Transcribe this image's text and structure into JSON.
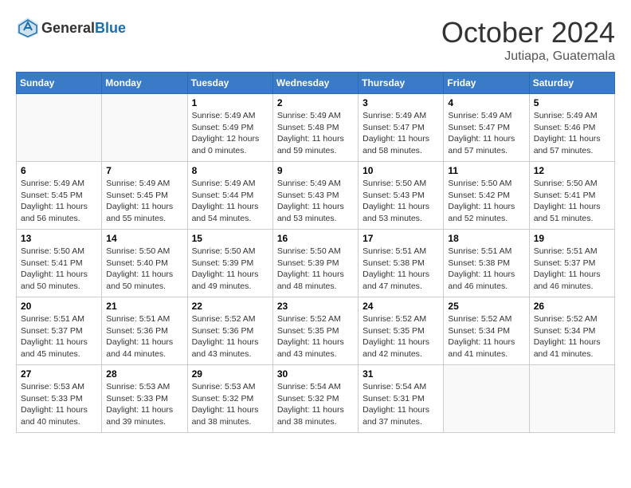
{
  "header": {
    "logo_general": "General",
    "logo_blue": "Blue",
    "month_title": "October 2024",
    "subtitle": "Jutiapa, Guatemala"
  },
  "weekdays": [
    "Sunday",
    "Monday",
    "Tuesday",
    "Wednesday",
    "Thursday",
    "Friday",
    "Saturday"
  ],
  "weeks": [
    [
      {
        "day": "",
        "sunrise": "",
        "sunset": "",
        "daylight": "",
        "empty": true
      },
      {
        "day": "",
        "sunrise": "",
        "sunset": "",
        "daylight": "",
        "empty": true
      },
      {
        "day": "1",
        "sunrise": "Sunrise: 5:49 AM",
        "sunset": "Sunset: 5:49 PM",
        "daylight": "Daylight: 12 hours and 0 minutes."
      },
      {
        "day": "2",
        "sunrise": "Sunrise: 5:49 AM",
        "sunset": "Sunset: 5:48 PM",
        "daylight": "Daylight: 11 hours and 59 minutes."
      },
      {
        "day": "3",
        "sunrise": "Sunrise: 5:49 AM",
        "sunset": "Sunset: 5:47 PM",
        "daylight": "Daylight: 11 hours and 58 minutes."
      },
      {
        "day": "4",
        "sunrise": "Sunrise: 5:49 AM",
        "sunset": "Sunset: 5:47 PM",
        "daylight": "Daylight: 11 hours and 57 minutes."
      },
      {
        "day": "5",
        "sunrise": "Sunrise: 5:49 AM",
        "sunset": "Sunset: 5:46 PM",
        "daylight": "Daylight: 11 hours and 57 minutes."
      }
    ],
    [
      {
        "day": "6",
        "sunrise": "Sunrise: 5:49 AM",
        "sunset": "Sunset: 5:45 PM",
        "daylight": "Daylight: 11 hours and 56 minutes."
      },
      {
        "day": "7",
        "sunrise": "Sunrise: 5:49 AM",
        "sunset": "Sunset: 5:45 PM",
        "daylight": "Daylight: 11 hours and 55 minutes."
      },
      {
        "day": "8",
        "sunrise": "Sunrise: 5:49 AM",
        "sunset": "Sunset: 5:44 PM",
        "daylight": "Daylight: 11 hours and 54 minutes."
      },
      {
        "day": "9",
        "sunrise": "Sunrise: 5:49 AM",
        "sunset": "Sunset: 5:43 PM",
        "daylight": "Daylight: 11 hours and 53 minutes."
      },
      {
        "day": "10",
        "sunrise": "Sunrise: 5:50 AM",
        "sunset": "Sunset: 5:43 PM",
        "daylight": "Daylight: 11 hours and 53 minutes."
      },
      {
        "day": "11",
        "sunrise": "Sunrise: 5:50 AM",
        "sunset": "Sunset: 5:42 PM",
        "daylight": "Daylight: 11 hours and 52 minutes."
      },
      {
        "day": "12",
        "sunrise": "Sunrise: 5:50 AM",
        "sunset": "Sunset: 5:41 PM",
        "daylight": "Daylight: 11 hours and 51 minutes."
      }
    ],
    [
      {
        "day": "13",
        "sunrise": "Sunrise: 5:50 AM",
        "sunset": "Sunset: 5:41 PM",
        "daylight": "Daylight: 11 hours and 50 minutes."
      },
      {
        "day": "14",
        "sunrise": "Sunrise: 5:50 AM",
        "sunset": "Sunset: 5:40 PM",
        "daylight": "Daylight: 11 hours and 50 minutes."
      },
      {
        "day": "15",
        "sunrise": "Sunrise: 5:50 AM",
        "sunset": "Sunset: 5:39 PM",
        "daylight": "Daylight: 11 hours and 49 minutes."
      },
      {
        "day": "16",
        "sunrise": "Sunrise: 5:50 AM",
        "sunset": "Sunset: 5:39 PM",
        "daylight": "Daylight: 11 hours and 48 minutes."
      },
      {
        "day": "17",
        "sunrise": "Sunrise: 5:51 AM",
        "sunset": "Sunset: 5:38 PM",
        "daylight": "Daylight: 11 hours and 47 minutes."
      },
      {
        "day": "18",
        "sunrise": "Sunrise: 5:51 AM",
        "sunset": "Sunset: 5:38 PM",
        "daylight": "Daylight: 11 hours and 46 minutes."
      },
      {
        "day": "19",
        "sunrise": "Sunrise: 5:51 AM",
        "sunset": "Sunset: 5:37 PM",
        "daylight": "Daylight: 11 hours and 46 minutes."
      }
    ],
    [
      {
        "day": "20",
        "sunrise": "Sunrise: 5:51 AM",
        "sunset": "Sunset: 5:37 PM",
        "daylight": "Daylight: 11 hours and 45 minutes."
      },
      {
        "day": "21",
        "sunrise": "Sunrise: 5:51 AM",
        "sunset": "Sunset: 5:36 PM",
        "daylight": "Daylight: 11 hours and 44 minutes."
      },
      {
        "day": "22",
        "sunrise": "Sunrise: 5:52 AM",
        "sunset": "Sunset: 5:36 PM",
        "daylight": "Daylight: 11 hours and 43 minutes."
      },
      {
        "day": "23",
        "sunrise": "Sunrise: 5:52 AM",
        "sunset": "Sunset: 5:35 PM",
        "daylight": "Daylight: 11 hours and 43 minutes."
      },
      {
        "day": "24",
        "sunrise": "Sunrise: 5:52 AM",
        "sunset": "Sunset: 5:35 PM",
        "daylight": "Daylight: 11 hours and 42 minutes."
      },
      {
        "day": "25",
        "sunrise": "Sunrise: 5:52 AM",
        "sunset": "Sunset: 5:34 PM",
        "daylight": "Daylight: 11 hours and 41 minutes."
      },
      {
        "day": "26",
        "sunrise": "Sunrise: 5:52 AM",
        "sunset": "Sunset: 5:34 PM",
        "daylight": "Daylight: 11 hours and 41 minutes."
      }
    ],
    [
      {
        "day": "27",
        "sunrise": "Sunrise: 5:53 AM",
        "sunset": "Sunset: 5:33 PM",
        "daylight": "Daylight: 11 hours and 40 minutes."
      },
      {
        "day": "28",
        "sunrise": "Sunrise: 5:53 AM",
        "sunset": "Sunset: 5:33 PM",
        "daylight": "Daylight: 11 hours and 39 minutes."
      },
      {
        "day": "29",
        "sunrise": "Sunrise: 5:53 AM",
        "sunset": "Sunset: 5:32 PM",
        "daylight": "Daylight: 11 hours and 38 minutes."
      },
      {
        "day": "30",
        "sunrise": "Sunrise: 5:54 AM",
        "sunset": "Sunset: 5:32 PM",
        "daylight": "Daylight: 11 hours and 38 minutes."
      },
      {
        "day": "31",
        "sunrise": "Sunrise: 5:54 AM",
        "sunset": "Sunset: 5:31 PM",
        "daylight": "Daylight: 11 hours and 37 minutes."
      },
      {
        "day": "",
        "sunrise": "",
        "sunset": "",
        "daylight": "",
        "empty": true
      },
      {
        "day": "",
        "sunrise": "",
        "sunset": "",
        "daylight": "",
        "empty": true
      }
    ]
  ]
}
